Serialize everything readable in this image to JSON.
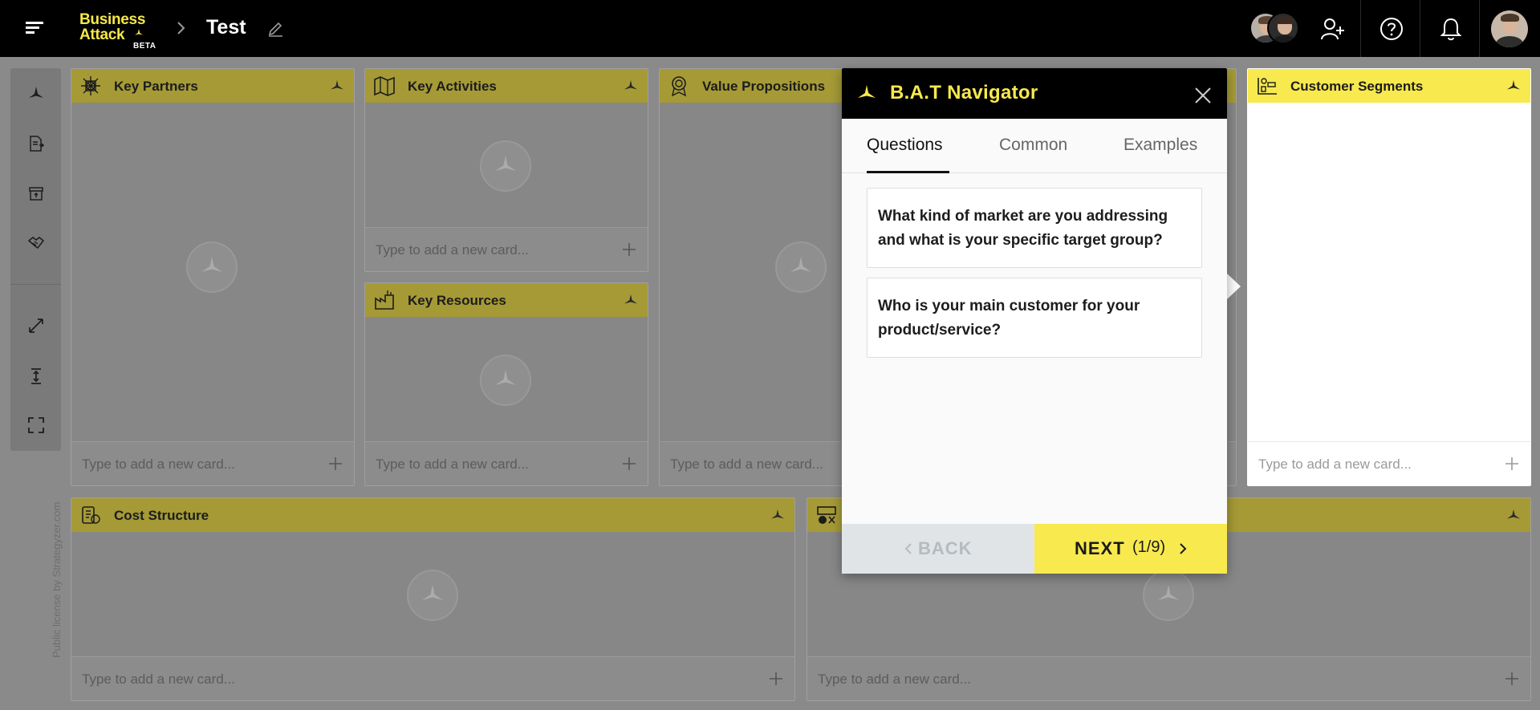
{
  "app": {
    "logo_line1": "Business",
    "logo_line2": "Attack",
    "logo_badge": "BETA",
    "board_title": "Test",
    "license_text": "Public license by Strategyzer.com"
  },
  "topbar_icons": [
    "menu-icon",
    "chevron-right-icon",
    "pencil-icon",
    "add-user-icon",
    "help-icon",
    "bell-icon"
  ],
  "blocks": {
    "key_partners": {
      "title": "Key Partners",
      "input_placeholder": "Type to add a new card...",
      "icon": "network-icon"
    },
    "key_activities": {
      "title": "Key Activities",
      "input_placeholder": "Type to add a new card...",
      "icon": "map-icon"
    },
    "key_resources": {
      "title": "Key Resources",
      "input_placeholder": "Type to add a new card...",
      "icon": "factory-icon"
    },
    "value_propositions": {
      "title": "Value Propositions",
      "input_placeholder": "Type to add a new card...",
      "icon": "award-icon"
    },
    "customer_segments": {
      "title": "Customer Segments",
      "input_placeholder": "Type to add a new card...",
      "icon": "segments-icon"
    },
    "cost_structure": {
      "title": "Cost Structure",
      "input_placeholder": "Type to add a new card...",
      "icon": "cost-icon"
    },
    "revenue_streams": {
      "title": "",
      "input_placeholder": "Type to add a new card...",
      "icon": "revenue-icon"
    }
  },
  "navigator": {
    "title": "B.A.T Navigator",
    "tabs": [
      "Questions",
      "Common",
      "Examples"
    ],
    "active_tab": "Questions",
    "questions": [
      "What kind of market are you addressing and what is your specific target group?",
      "Who is your main customer for your product/service?"
    ],
    "back_label": "BACK",
    "next_label": "NEXT",
    "step_counter": "(1/9)"
  },
  "colors": {
    "brand_yellow": "#f7e94e",
    "header_black": "#000000",
    "dim_header": "#a59a36",
    "overlay_gray": "#8a8a8a"
  }
}
